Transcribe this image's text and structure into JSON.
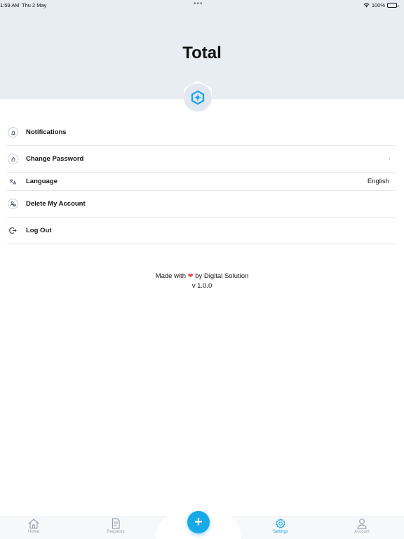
{
  "status_bar": {
    "time": "1:59 AM",
    "date": "Thu 2 May",
    "dots": "•••",
    "battery": "100%"
  },
  "header": {
    "title": "Total"
  },
  "menu": [
    {
      "label": "Notifications",
      "value": ""
    },
    {
      "label": "Change Password",
      "value": ""
    },
    {
      "label": "Language",
      "value": "English"
    },
    {
      "label": "Delete My Account",
      "value": ""
    },
    {
      "label": "Log Out",
      "value": ""
    }
  ],
  "footer": {
    "made_prefix": "Made with",
    "heart": "❤",
    "made_suffix": "by Digital Solution",
    "version": "v 1.0.0"
  },
  "tabs": [
    {
      "label": "Home"
    },
    {
      "label": "Requests"
    },
    {
      "label": "Settings"
    },
    {
      "label": "Account"
    }
  ],
  "fab": {
    "symbol": "+"
  },
  "colors": {
    "accent": "#1ea6e6",
    "header_bg": "#e8ecf3",
    "heart": "#e74c4c"
  }
}
